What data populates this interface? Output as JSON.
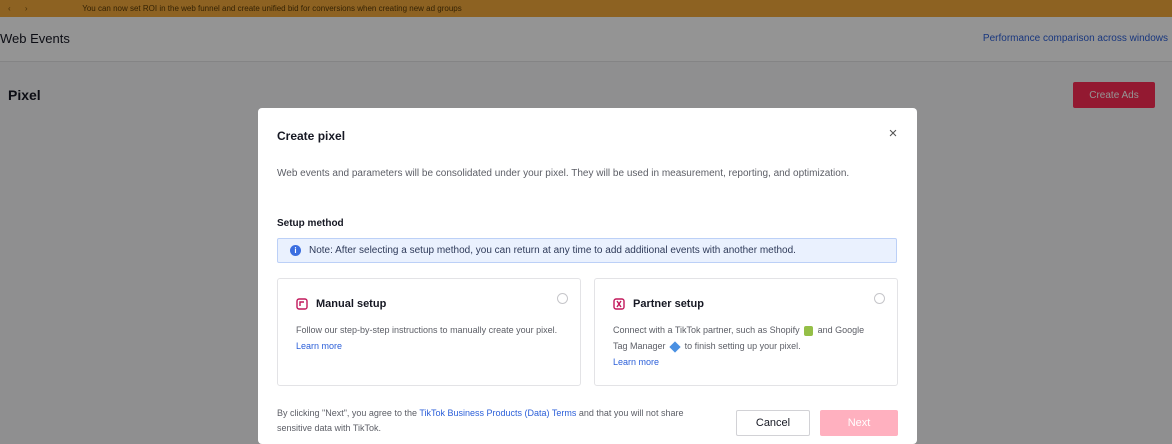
{
  "banner": {
    "nav": "‹ ›",
    "message": "You can now set ROI in the web funnel and create unified bid for conversions when creating new ad groups"
  },
  "header": {
    "breadcrumb": "Web Events",
    "right_link": "Performance comparison across windows"
  },
  "page": {
    "title": "Pixel",
    "create_ads_label": "Create Ads"
  },
  "modal": {
    "title": "Create pixel",
    "close_label": "×",
    "description": "Web events and parameters will be consolidated under your pixel. They will be used in measurement, reporting, and optimization.",
    "setup_label": "Setup method",
    "note": {
      "icon": "i",
      "text": "Note: After selecting a setup method, you can return at any time to add additional events with another method."
    },
    "manual": {
      "title": "Manual setup",
      "desc": "Follow our step-by-step instructions to manually create your pixel.",
      "learn_more": "Learn more"
    },
    "partner": {
      "title": "Partner setup",
      "desc_a": "Connect with a TikTok partner, such as Shopify",
      "desc_b": "and Google Tag Manager",
      "desc_c": "to finish setting up your pixel.",
      "learn_more": "Learn more"
    },
    "footer": {
      "prefix": "By clicking \"Next\", you agree to the",
      "terms": "TikTok Business Products (Data) Terms",
      "suffix": "and that you will not share sensitive data with TikTok."
    },
    "cancel_label": "Cancel",
    "next_label": "Next"
  },
  "colors": {
    "banner": "#f3a93c",
    "primary": "#fe2c55",
    "primary_disabled": "#ffb0bf",
    "link": "#2b5fd9",
    "note_bg": "#eaf1fe"
  }
}
